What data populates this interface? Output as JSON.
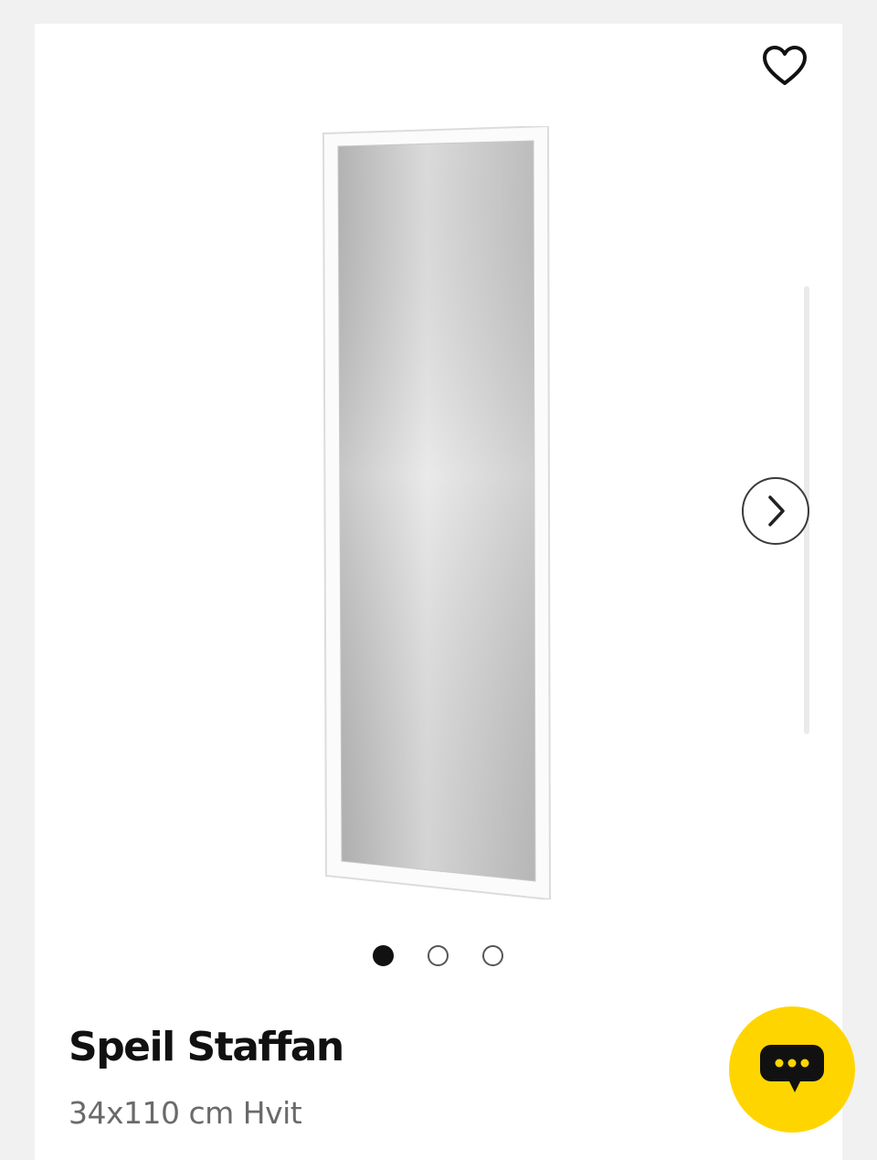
{
  "product": {
    "title": "Speil Staffan",
    "subtitle": "34x110 cm Hvit"
  },
  "gallery": {
    "image_alt": "Speil Staffan",
    "dot_count": 3,
    "active_index": 0
  },
  "icons": {
    "favorite": "heart-icon",
    "next": "chevron-right-icon",
    "chat": "chat-bubble-icon"
  },
  "colors": {
    "page_background": "#f1f1f1",
    "card_background": "#ffffff",
    "chat_button": "#ffd500",
    "chat_bubble": "#111111",
    "text_primary": "#111111",
    "text_secondary": "#6a6a6a"
  }
}
